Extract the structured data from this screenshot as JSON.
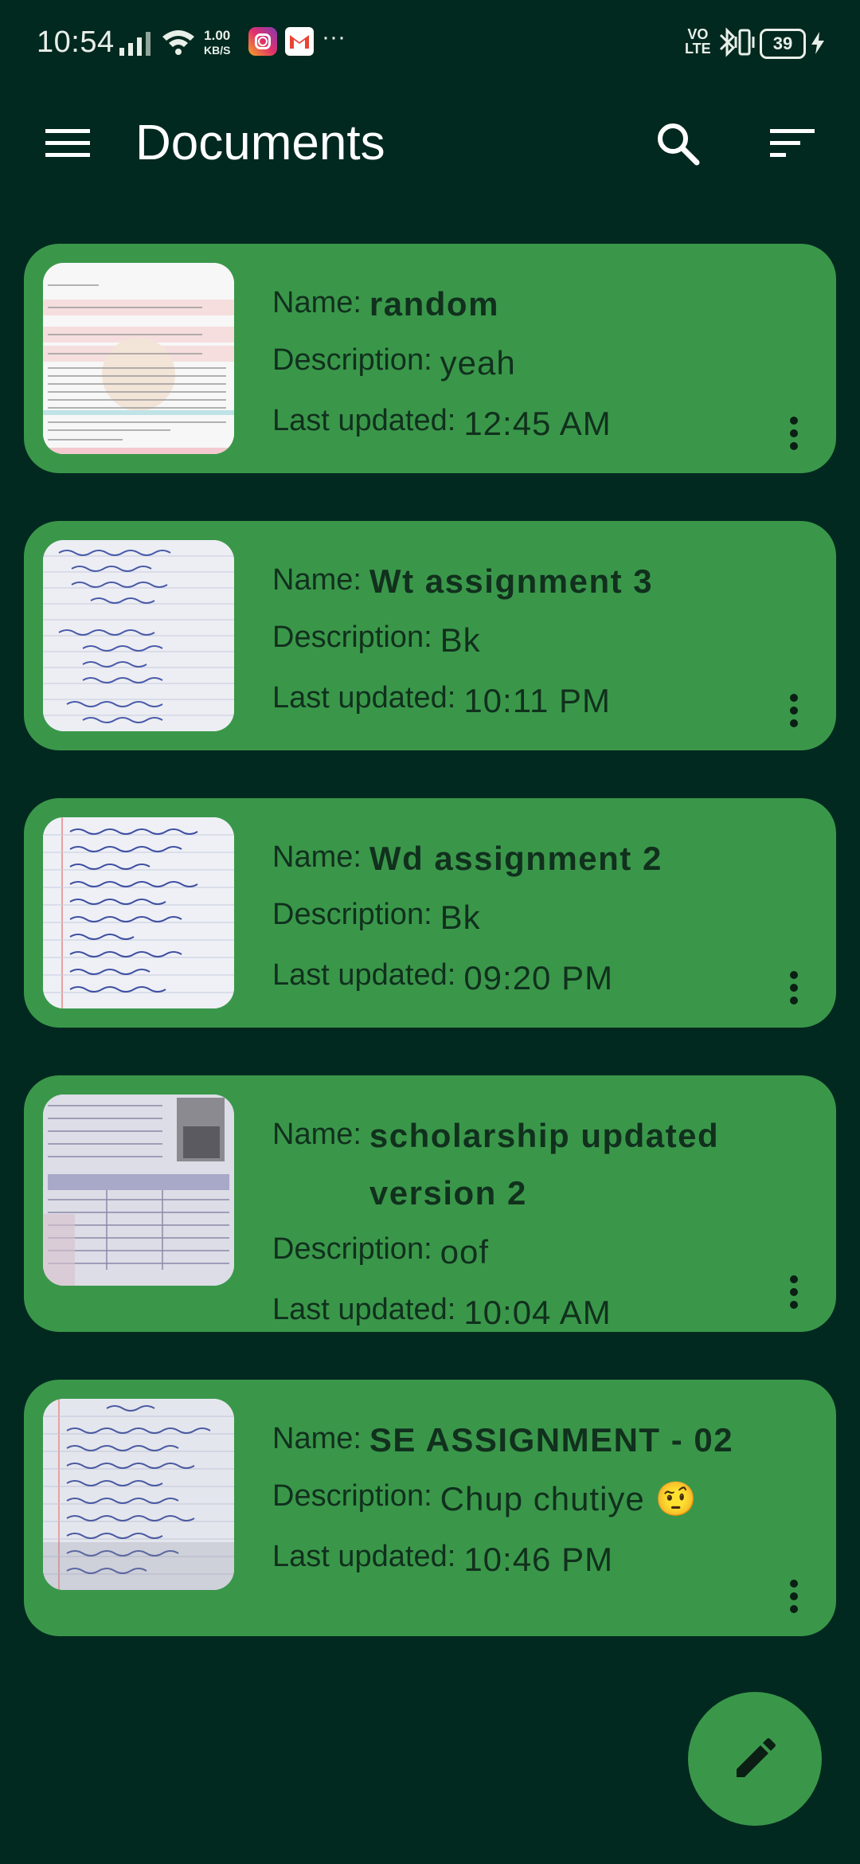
{
  "status_bar": {
    "time": "10:54",
    "speed_value": "1.00",
    "speed_unit": "KB/S",
    "more": "···",
    "volte_top": "VO",
    "volte_bottom": "LTE",
    "battery": "39",
    "icons": [
      "signal-icon",
      "wifi-icon",
      "instagram-icon",
      "gmail-icon",
      "bluetooth-icon",
      "vibrate-icon",
      "charging-icon"
    ]
  },
  "app_bar": {
    "title": "Documents",
    "icons": [
      "menu-icon",
      "search-icon",
      "sort-icon"
    ]
  },
  "documents": [
    {
      "name_label": "Name:",
      "name": "random",
      "description_label": "Description:",
      "description": "yeah",
      "updated_label": "Last updated:",
      "updated": "12:45 AM"
    },
    {
      "name_label": "Name:",
      "name": "Wt assignment 3",
      "description_label": "Description:",
      "description": "Bk",
      "updated_label": "Last updated:",
      "updated": "10:11 PM"
    },
    {
      "name_label": "Name:",
      "name": "Wd assignment 2",
      "description_label": "Description:",
      "description": "Bk",
      "updated_label": "Last updated:",
      "updated": "09:20 PM"
    },
    {
      "name_label": "Name:",
      "name": "scholarship updated version 2",
      "description_label": "Description:",
      "description": "oof",
      "updated_label": "Last updated:",
      "updated": "10:04 AM"
    },
    {
      "name_label": "Name:",
      "name": "SE ASSIGNMENT - 02",
      "description_label": "Description:",
      "description": "Chup chutiye 🤨",
      "updated_label": "Last updated:",
      "updated": "10:46 PM"
    }
  ],
  "fab": {
    "icon": "pencil-icon"
  },
  "colors": {
    "background": "#02291f",
    "card": "#3a974a",
    "text_dark": "#11301d"
  }
}
